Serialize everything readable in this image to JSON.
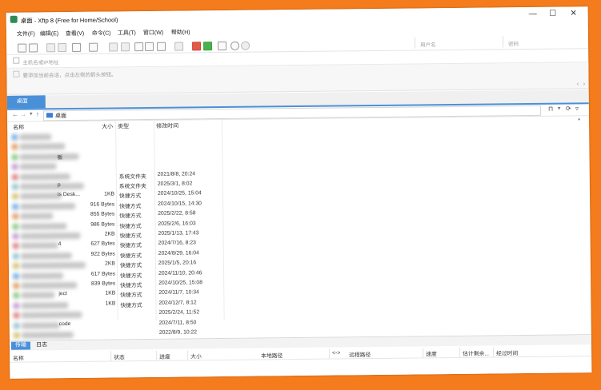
{
  "window": {
    "title": "桌面 - Xftp 8 (Free for Home/School)",
    "minimize": "—",
    "maximize": "☐",
    "close": "✕"
  },
  "menu": [
    "文件(F)",
    "编辑(E)",
    "查看(V)",
    "命令(C)",
    "工具(T)",
    "窗口(W)",
    "帮助(H)"
  ],
  "connection": {
    "host_placeholder": "主机名或IP地址",
    "user_placeholder": "用户名",
    "password_placeholder": "密码"
  },
  "session_hint": "要添加当前会话，点击左侧的箭头按钮。",
  "tab": {
    "label": "桌面"
  },
  "path": {
    "value": "桌面"
  },
  "columns": {
    "name": "名称",
    "size": "大小",
    "type": "类型",
    "modified": "修改时间"
  },
  "rows": [
    {
      "name": "",
      "size": "",
      "type": "",
      "modified": ""
    },
    {
      "name": "",
      "size": "",
      "type": "",
      "modified": ""
    },
    {
      "name": "板",
      "size": "",
      "type": "",
      "modified": ""
    },
    {
      "name": "",
      "size": "",
      "type": "",
      "modified": ""
    },
    {
      "name": "",
      "size": "",
      "type": "系统文件夹",
      "modified": "2021/8/8, 20:24"
    },
    {
      "name": "p",
      "size": "",
      "type": "系统文件夹",
      "modified": "2025/3/1, 8:02"
    },
    {
      "name": "is Desk...",
      "size": "1KB",
      "type": "快捷方式",
      "modified": "2024/10/25, 15:04"
    },
    {
      "name": "",
      "size": "916 Bytes",
      "type": "快捷方式",
      "modified": "2024/10/15, 14:30"
    },
    {
      "name": "",
      "size": "855 Bytes",
      "type": "快捷方式",
      "modified": "2025/2/22, 8:58"
    },
    {
      "name": "",
      "size": "986 Bytes",
      "type": "快捷方式",
      "modified": "2025/2/6, 16:03"
    },
    {
      "name": "",
      "size": "2KB",
      "type": "快捷方式",
      "modified": "2025/1/13, 17:43"
    },
    {
      "name": "4",
      "size": "627 Bytes",
      "type": "快捷方式",
      "modified": "2024/7/16, 8:23"
    },
    {
      "name": "",
      "size": "922 Bytes",
      "type": "快捷方式",
      "modified": "2024/8/29, 16:04"
    },
    {
      "name": "",
      "size": "2KB",
      "type": "快捷方式",
      "modified": "2025/1/5, 20:16"
    },
    {
      "name": "",
      "size": "617 Bytes",
      "type": "快捷方式",
      "modified": "2024/11/10, 20:46"
    },
    {
      "name": "",
      "size": "839 Bytes",
      "type": "快捷方式",
      "modified": "2024/10/25, 15:08"
    },
    {
      "name": "ject",
      "size": "1KB",
      "type": "快捷方式",
      "modified": "2024/11/7, 10:34"
    },
    {
      "name": "",
      "size": "1KB",
      "type": "快捷方式",
      "modified": "2024/12/7, 8:12"
    },
    {
      "name": "",
      "size": "",
      "type": "",
      "modified": "2025/2/24, 11:52"
    },
    {
      "name": "code",
      "size": "",
      "type": "",
      "modified": "2024/7/11, 8:50"
    },
    {
      "name": "",
      "size": "",
      "type": "",
      "modified": "2022/8/9, 10:22"
    }
  ],
  "transfer": {
    "tabs": [
      "传输",
      "日志"
    ],
    "headers": [
      "名称",
      "状态",
      "进度",
      "大小",
      "本地路径",
      "<->",
      "远程路径",
      "速度",
      "估计剩余...",
      "经过时间"
    ]
  },
  "colors": {
    "accent": "#4a90d9",
    "frame": "#f47c1c"
  }
}
